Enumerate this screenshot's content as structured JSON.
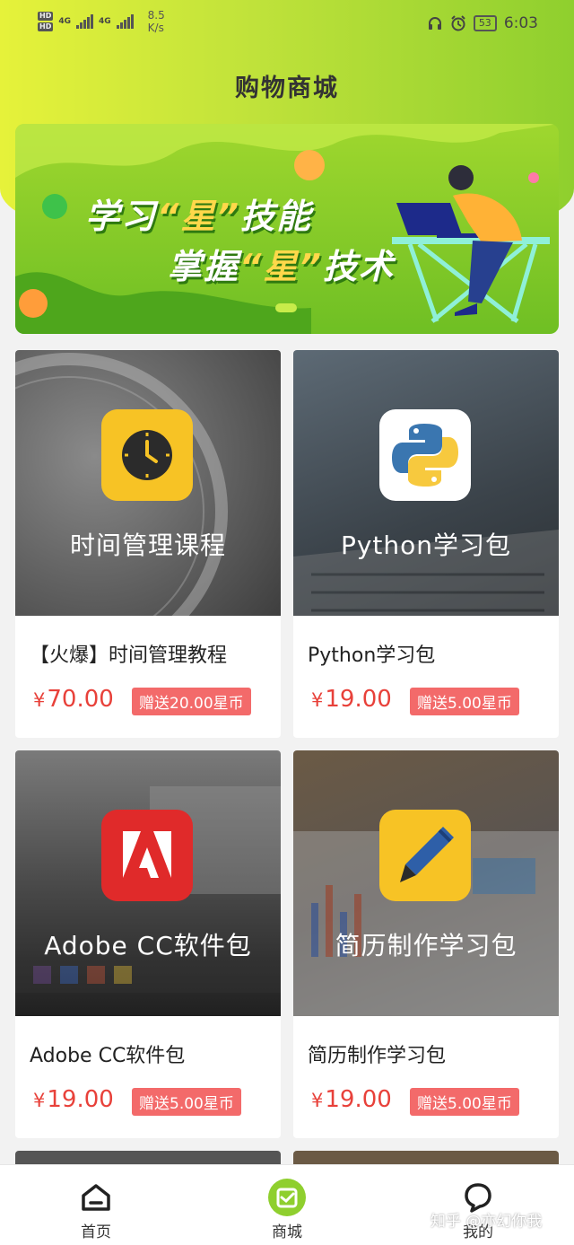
{
  "status_bar": {
    "hd1": "HD",
    "hd2": "HD",
    "net1": "4G",
    "net2": "4G",
    "speed_value": "8.5",
    "speed_unit": "K/s",
    "battery": "53",
    "time": "6:03"
  },
  "header": {
    "title": "购物商城"
  },
  "banner": {
    "line1_a": "学习",
    "line1_quote": "“星”",
    "line1_b": "技能",
    "line2_a": "掌握",
    "line2_quote": "“星”",
    "line2_b": "技术"
  },
  "products": [
    {
      "image_title": "时间管理课程",
      "name": "【火爆】时间管理教程",
      "currency": "¥",
      "price": "70.00",
      "gift": "赠送20.00星币",
      "icon": "clock-icon"
    },
    {
      "image_title": "Python学习包",
      "name": "Python学习包",
      "currency": "¥",
      "price": "19.00",
      "gift": "赠送5.00星币",
      "icon": "python-icon"
    },
    {
      "image_title": "Adobe CC软件包",
      "name": "Adobe CC软件包",
      "currency": "¥",
      "price": "19.00",
      "gift": "赠送5.00星币",
      "icon": "adobe-icon"
    },
    {
      "image_title": "简历制作学习包",
      "name": "简历制作学习包",
      "currency": "¥",
      "price": "19.00",
      "gift": "赠送5.00星币",
      "icon": "pen-icon"
    }
  ],
  "tabbar": {
    "home": "首页",
    "mall": "商城",
    "mine": "我的",
    "active_color": "#8fcf2e"
  },
  "watermark": "知乎 @亦幻你我"
}
